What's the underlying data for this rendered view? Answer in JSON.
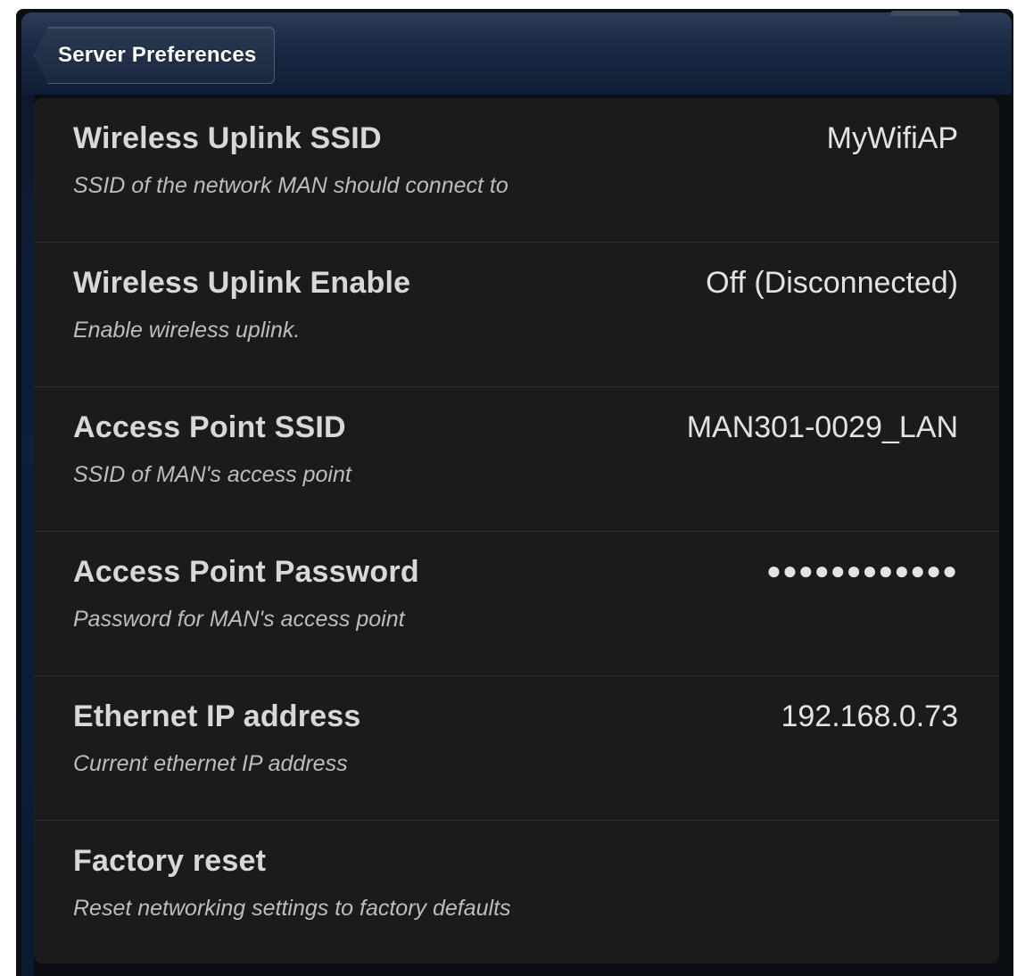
{
  "navbar": {
    "back_label": "Server Preferences"
  },
  "colors": {
    "navbar_top": "#2c3d58",
    "navbar_bottom": "#0f1e36",
    "panel_bg": "#1b1b1c",
    "title_text": "#d8d8d8",
    "desc_text": "#bdbdbd",
    "value_text": "#e3e3e3"
  },
  "settings": [
    {
      "title": "Wireless Uplink SSID",
      "description": "SSID of the network MAN should connect to",
      "value": "MyWifiAP"
    },
    {
      "title": "Wireless Uplink Enable",
      "description": "Enable wireless uplink.",
      "value": "Off (Disconnected)"
    },
    {
      "title": "Access Point SSID",
      "description": "SSID of MAN's access point",
      "value": "MAN301-0029_LAN"
    },
    {
      "title": "Access Point Password",
      "description": "Password for MAN's access point",
      "value": "●●●●●●●●●●●●"
    },
    {
      "title": "Ethernet IP address",
      "description": "Current ethernet IP address",
      "value": "192.168.0.73"
    },
    {
      "title": "Factory reset",
      "description": "Reset networking settings to factory defaults",
      "value": ""
    }
  ]
}
